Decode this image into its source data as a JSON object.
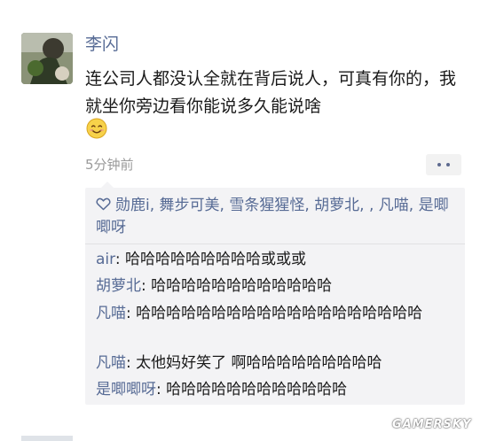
{
  "post": {
    "author": "李闪",
    "text": "连公司人都没认全就在背后说人，可真有你的，我就坐你旁边看你能说多久能说啥",
    "emoji": "smile-emoji",
    "time": "5分钟前"
  },
  "likes": {
    "icon": "heart-outline-icon",
    "names": "勋鹿i, 舞步可美, 雪条猩猩怪, 胡萝北, , 凡喵, 是唧唧呀"
  },
  "comments": [
    {
      "author": "air",
      "text": "哈哈哈哈哈哈哈哈哈或或或"
    },
    {
      "author": "胡萝北",
      "text": "哈哈哈哈哈哈哈哈哈哈哈哈"
    },
    {
      "author": "凡喵",
      "text": "哈哈哈哈哈哈哈哈哈哈哈哈哈哈哈哈哈哈哈"
    },
    {
      "author": "凡喵",
      "text": "太他妈好笑了 啊哈哈哈哈哈哈哈哈哈"
    },
    {
      "author": "是唧唧呀",
      "text": "哈哈哈哈哈哈哈哈哈哈哈哈"
    }
  ],
  "comment_separator": ": ",
  "watermark": "GAMERSKY",
  "colors": {
    "name_link": "#576b95",
    "body_text": "#1a1a1a",
    "timestamp": "#9a9a9a",
    "comment_bg": "#f3f3f5"
  }
}
